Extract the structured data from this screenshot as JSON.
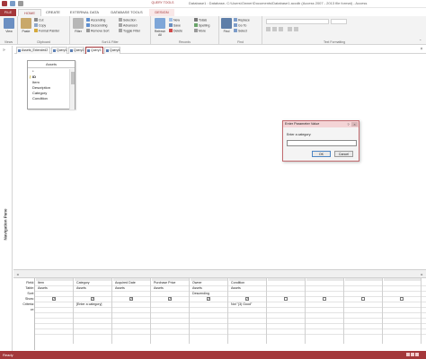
{
  "window": {
    "title": "Database1 : Database- C:\\Users\\Owner\\Documents\\Database1.accdb (Access 2007 - 2013 file format) - Access",
    "contextual_tab_group": "QUERY TOOLS"
  },
  "ribbon_tabs": [
    "FILE",
    "HOME",
    "CREATE",
    "EXTERNAL DATA",
    "DATABASE TOOLS",
    "DESIGN"
  ],
  "ribbon": {
    "views": {
      "view_label": "View",
      "group_label": "Views"
    },
    "clipboard": {
      "paste_label": "Paste",
      "cut": "Cut",
      "copy": "Copy",
      "format_painter": "Format Painter",
      "group_label": "Clipboard"
    },
    "sort_filter": {
      "filter_label": "Filter",
      "ascending": "Ascending",
      "descending": "Descending",
      "remove_sort": "Remove Sort",
      "selection": "Selection",
      "advanced": "Advanced",
      "toggle_filter": "Toggle Filter",
      "group_label": "Sort & Filter"
    },
    "records": {
      "refresh_label": "Refresh All",
      "new": "New",
      "save": "Save",
      "delete": "Delete",
      "totals": "Totals",
      "spelling": "Spelling",
      "more": "More",
      "group_label": "Records"
    },
    "find": {
      "find_label": "Find",
      "replace": "Replace",
      "goto": "Go To",
      "select": "Select",
      "group_label": "Find"
    },
    "text_formatting": {
      "group_label": "Text Formatting"
    }
  },
  "object_tabs": [
    {
      "label": "Assets_Extended2"
    },
    {
      "label": "Query1"
    },
    {
      "label": "Query2"
    },
    {
      "label": "Query3"
    },
    {
      "label": "Query4"
    }
  ],
  "active_object_tab": "Query3",
  "nav_pane": {
    "label": "Navigation Pane"
  },
  "field_list": {
    "title": "Assets",
    "fields": [
      {
        "name": "*"
      },
      {
        "name": "ID",
        "key": true
      },
      {
        "name": "Item"
      },
      {
        "name": "Description"
      },
      {
        "name": "Category"
      },
      {
        "name": "Condition"
      }
    ]
  },
  "dialog": {
    "title": "Enter Parameter Value",
    "prompt": "Enter a category:",
    "input_value": "",
    "ok_label": "OK",
    "cancel_label": "Cancel"
  },
  "qbe": {
    "row_headers": [
      "Field:",
      "Table:",
      "Sort:",
      "Show:",
      "Criteria:",
      "or:"
    ],
    "columns": [
      {
        "field": "Item",
        "table": "Assets",
        "sort": "",
        "show": true,
        "criteria": "",
        "or": ""
      },
      {
        "field": "Category",
        "table": "Assets",
        "sort": "",
        "show": true,
        "criteria": "[Enter a category]",
        "or": ""
      },
      {
        "field": "Acquired Date",
        "table": "Assets",
        "sort": "",
        "show": true,
        "criteria": "",
        "or": ""
      },
      {
        "field": "Purchase Price",
        "table": "Assets",
        "sort": "",
        "show": true,
        "criteria": "",
        "or": ""
      },
      {
        "field": "Owner",
        "table": "Assets",
        "sort": "Descending",
        "show": true,
        "criteria": "",
        "or": ""
      },
      {
        "field": "Condition",
        "table": "Assets",
        "sort": "",
        "show": true,
        "criteria": "Not \"(3) Good\"",
        "or": ""
      },
      {
        "field": "",
        "table": "",
        "sort": "",
        "show": false,
        "criteria": "",
        "or": ""
      },
      {
        "field": "",
        "table": "",
        "sort": "",
        "show": false,
        "criteria": "",
        "or": ""
      },
      {
        "field": "",
        "table": "",
        "sort": "",
        "show": false,
        "criteria": "",
        "or": ""
      },
      {
        "field": "",
        "table": "",
        "sort": "",
        "show": false,
        "criteria": "",
        "or": ""
      }
    ]
  },
  "status": {
    "text": "Ready"
  },
  "colors": {
    "accent": "#a4373a",
    "dialog_border": "#c26b6f"
  }
}
